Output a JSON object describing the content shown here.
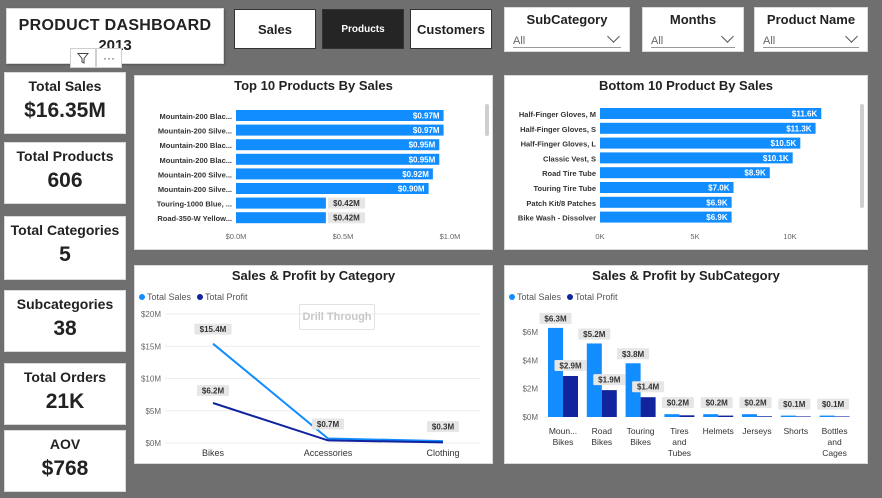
{
  "header": {
    "title": "PRODUCT DASHBOARD",
    "year": "2013",
    "tools": [
      "filter-icon",
      "more-icon"
    ]
  },
  "nav": {
    "sales": "Sales",
    "products": "Products",
    "customers": "Customers"
  },
  "slicers": {
    "subcategory": {
      "title": "SubCategory",
      "value": "All"
    },
    "months": {
      "title": "Months",
      "value": "All"
    },
    "product_name": {
      "title": "Product Name",
      "value": "All"
    }
  },
  "kpis": [
    {
      "label": "Total Sales",
      "value": "$16.35M"
    },
    {
      "label": "Total Products",
      "value": "606"
    },
    {
      "label": "Total Categories",
      "value": "5"
    },
    {
      "label": "Subcategories",
      "value": "38"
    },
    {
      "label": "Total Orders",
      "value": "21K"
    },
    {
      "label": "AOV",
      "value": "$768"
    }
  ],
  "colors": {
    "bar": "#118dff",
    "sales": "#118dff",
    "profit": "#12239e",
    "label_bg": "#e6e6e6"
  },
  "chart_data": [
    {
      "type": "bar",
      "title": "Top 10 Products By Sales",
      "orientation": "horizontal",
      "categories": [
        "Mountain-200 Blac...",
        "Mountain-200 Silve...",
        "Mountain-200 Blac...",
        "Mountain-200 Blac...",
        "Mountain-200 Silve...",
        "Mountain-200 Silve...",
        "Touring-1000 Blue, ...",
        "Road-350-W Yellow..."
      ],
      "values": [
        0.97,
        0.97,
        0.95,
        0.95,
        0.92,
        0.9,
        0.42,
        0.42
      ],
      "labels": [
        "$0.97M",
        "$0.97M",
        "$0.95M",
        "$0.95M",
        "$0.92M",
        "$0.90M",
        "$0.42M",
        "$0.42M"
      ],
      "xticks": [
        "$0.0M",
        "$0.5M",
        "$1.0M"
      ],
      "xlim": [
        0,
        1.0
      ]
    },
    {
      "type": "bar",
      "title": "Bottom 10 Product By Sales",
      "orientation": "horizontal",
      "categories": [
        "Half-Finger Gloves, M",
        "Half-Finger Gloves, S",
        "Half-Finger Gloves, L",
        "Classic Vest, S",
        "Road Tire Tube",
        "Touring Tire Tube",
        "Patch Kit/8 Patches",
        "Bike Wash - Dissolver"
      ],
      "values": [
        11.6,
        11.3,
        10.5,
        10.1,
        8.9,
        7.0,
        6.9,
        6.9
      ],
      "labels": [
        "$11.6K",
        "$11.3K",
        "$10.5K",
        "$10.1K",
        "$8.9K",
        "$7.0K",
        "$6.9K",
        "$6.9K"
      ],
      "xticks": [
        "0K",
        "5K",
        "10K"
      ],
      "xlim": [
        0,
        13
      ]
    },
    {
      "type": "line",
      "title": "Sales & Profit by Category",
      "categories": [
        "Bikes",
        "Accessories",
        "Clothing"
      ],
      "series": [
        {
          "name": "Total Sales",
          "values": [
            15.4,
            0.7,
            0.3
          ],
          "labels": [
            "$15.4M",
            "$0.7M",
            "$0.3M"
          ]
        },
        {
          "name": "Total Profit",
          "values": [
            6.2,
            0.4,
            0.1
          ],
          "labels": [
            "$6.2M",
            "",
            ""
          ]
        }
      ],
      "yticks": [
        "$0M",
        "$5M",
        "$10M",
        "$15M",
        "$20M"
      ],
      "ylim": [
        0,
        20
      ],
      "button": "Drill Through"
    },
    {
      "type": "bar",
      "title": "Sales & Profit by SubCategory",
      "categories": [
        "Moun... Bikes",
        "Road Bikes",
        "Touring Bikes",
        "Tires and Tubes",
        "Helmets",
        "Jerseys",
        "Shorts",
        "Bottles and Cages"
      ],
      "series": [
        {
          "name": "Total Sales",
          "values": [
            6.3,
            5.2,
            3.8,
            0.2,
            0.2,
            0.2,
            0.1,
            0.1
          ],
          "labels": [
            "$6.3M",
            "$5.2M",
            "$3.8M",
            "$0.2M",
            "$0.2M",
            "$0.2M",
            "$0.1M",
            "$0.1M"
          ]
        },
        {
          "name": "Total Profit",
          "values": [
            2.9,
            1.9,
            1.4,
            0.12,
            0.1,
            0.05,
            0.04,
            0.04
          ],
          "labels": [
            "$2.9M",
            "$1.9M",
            "$1.4M",
            "",
            "",
            "",
            "",
            ""
          ]
        }
      ],
      "yticks": [
        "$0M",
        "$2M",
        "$4M",
        "$6M"
      ],
      "ylim": [
        0,
        7
      ]
    }
  ]
}
